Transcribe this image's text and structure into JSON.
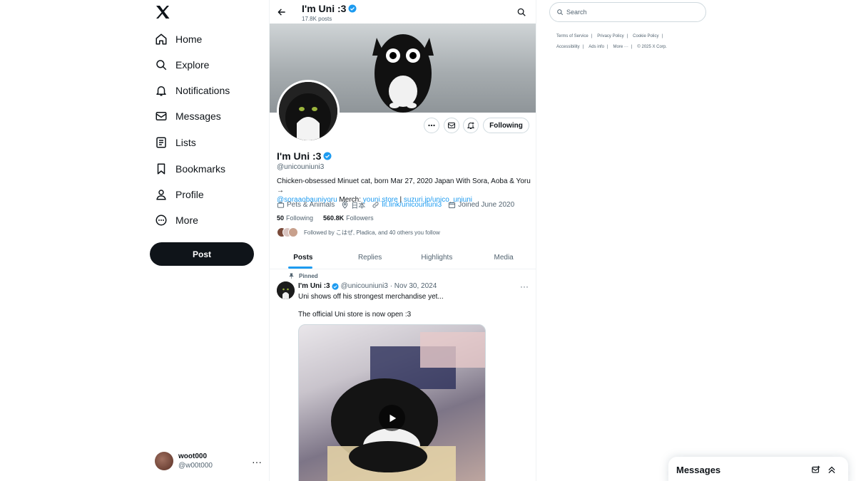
{
  "nav": {
    "items": [
      {
        "label": "Home",
        "icon": "home-icon"
      },
      {
        "label": "Explore",
        "icon": "search-icon"
      },
      {
        "label": "Notifications",
        "icon": "bell-icon"
      },
      {
        "label": "Messages",
        "icon": "envelope-icon"
      },
      {
        "label": "Lists",
        "icon": "list-icon"
      },
      {
        "label": "Bookmarks",
        "icon": "bookmark-icon"
      },
      {
        "label": "Profile",
        "icon": "person-icon"
      },
      {
        "label": "More",
        "icon": "more-circle-icon"
      }
    ],
    "post_label": "Post",
    "account": {
      "name": "woot000",
      "handle": "@w00t000",
      "menu": "···"
    }
  },
  "topbar": {
    "name": "I'm Uni :3",
    "posts": "17.8K posts"
  },
  "profile": {
    "name": "I'm Uni :3",
    "handle": "@unicouniuni3",
    "following_label": "Following",
    "bio": {
      "text1": "Chicken-obsessed Minuet cat, born Mar 27, 2020 Japan With Sora, Aoba & Yoru →",
      "mention": "@soraaobauniyoru",
      "merch": " Merch: ",
      "link1": "youni.store",
      "pipe": " | ",
      "link2": "suzuri.jp/unico_uniuni"
    },
    "category": "Pets & Animals",
    "location": "日本",
    "website": "lit.link/unicouniuni3",
    "joined": "Joined June 2020",
    "following_count": "50",
    "following_text": "Following",
    "followers_count": "560.8K",
    "followers_text": "Followers",
    "followed_by": "Followed by こはぜ, Pladica, and 40 others you follow"
  },
  "tabs": [
    "Posts",
    "Replies",
    "Highlights",
    "Media"
  ],
  "pinned_tweet": {
    "pinned_label": "Pinned",
    "name": "I'm Uni :3",
    "handle_date": "@unicouniuni3 · Nov 30, 2024",
    "line1": "Uni shows off his strongest merchandise yet...",
    "line2": "The official Uni store is now open :3",
    "menu": "···"
  },
  "search": {
    "placeholder": "Search"
  },
  "footer": {
    "row1": [
      "Terms of Service",
      "Privacy Policy",
      "Cookie Policy"
    ],
    "row2": [
      "Accessibility",
      "Ads info",
      "More ···"
    ],
    "copyright": "© 2025 X Corp."
  },
  "messages_dock": {
    "title": "Messages"
  },
  "colors": {
    "accent": "#1d9bf0",
    "text": "#0f1419",
    "muted": "#536471",
    "verified": "#1d9bf0"
  }
}
